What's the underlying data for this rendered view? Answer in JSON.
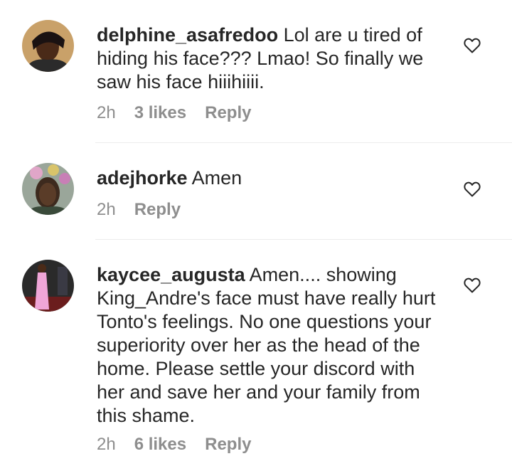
{
  "comments": [
    {
      "username": "delphine_asafredoo",
      "text_lines": [
        " Lol are u tired of",
        "hiding his face??? Lmao! So finally we",
        "saw his face hiiihiiii."
      ],
      "time": "2h",
      "likes": "3 likes",
      "reply": "Reply",
      "avatar_icon": "avatar-photo"
    },
    {
      "username": "adejhorke",
      "text_lines": [
        " Amen"
      ],
      "time": "2h",
      "likes": "",
      "reply": "Reply",
      "avatar_icon": "avatar-photo"
    },
    {
      "username": "kaycee_augusta",
      "text_lines": [
        " Amen.... showing",
        "King_Andre's face must have really hurt",
        "Tonto's feelings. No one questions your",
        "superiority over her as the head of the",
        "home. Please settle your discord with",
        "her and save her and your family from",
        "this shame."
      ],
      "time": "2h",
      "likes": "6 likes",
      "reply": "Reply",
      "avatar_icon": "avatar-photo"
    }
  ],
  "icons": {
    "like": "heart-outline-icon"
  },
  "colors": {
    "text": "#262626",
    "secondary": "#8e8e8e",
    "divider": "#ececec"
  }
}
